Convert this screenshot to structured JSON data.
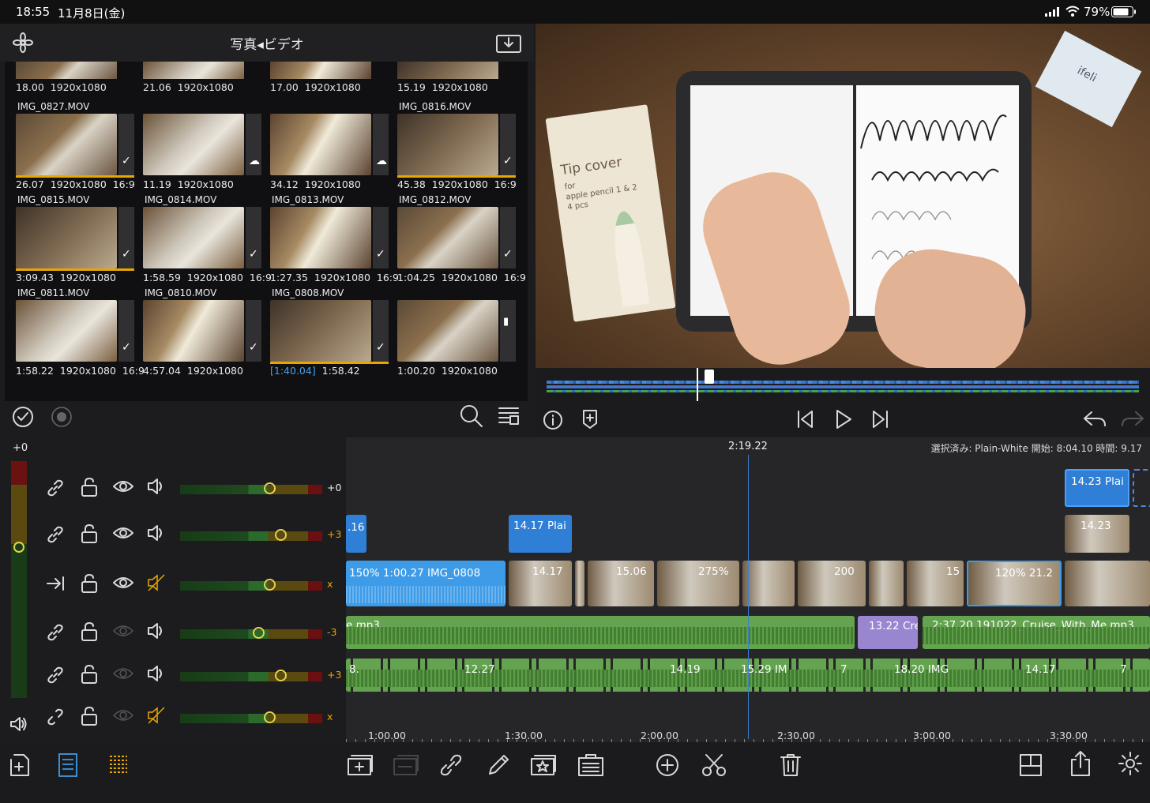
{
  "status_bar": {
    "time": "18:55",
    "date": "11月8日(金)",
    "battery": "79%"
  },
  "browser": {
    "title": "写真◂ビデオ",
    "top_row": [
      {
        "duration": "18.00",
        "resolution": "1920x1080"
      },
      {
        "duration": "21.06",
        "resolution": "1920x1080"
      },
      {
        "duration": "17.00",
        "resolution": "1920x1080"
      },
      {
        "duration": "15.19",
        "resolution": "1920x1080"
      }
    ],
    "clips": [
      {
        "name": "IMG_0827.MOV",
        "duration": "26.07",
        "resolution": "1920x1080",
        "aspect": "16:9",
        "used": true
      },
      {
        "name": "",
        "duration": "11.19",
        "resolution": "1920x1080",
        "aspect": "",
        "used": false
      },
      {
        "name": "",
        "duration": "34.12",
        "resolution": "1920x1080",
        "aspect": "",
        "used": false
      },
      {
        "name": "IMG_0816.MOV",
        "duration": "45.38",
        "resolution": "1920x1080",
        "aspect": "16:9",
        "used": true
      },
      {
        "name": "IMG_0815.MOV",
        "duration": "3:09.43",
        "resolution": "1920x1080",
        "aspect": "",
        "used": true
      },
      {
        "name": "IMG_0814.MOV",
        "duration": "1:58.59",
        "resolution": "1920x1080",
        "aspect": "16:9",
        "used": false
      },
      {
        "name": "IMG_0813.MOV",
        "duration": "1:27.35",
        "resolution": "1920x1080",
        "aspect": "16:9",
        "used": false
      },
      {
        "name": "IMG_0812.MOV",
        "duration": "1:04.25",
        "resolution": "1920x1080",
        "aspect": "16:9",
        "used": false
      },
      {
        "name": "IMG_0811.MOV",
        "duration": "1:58.22",
        "resolution": "1920x1080",
        "aspect": "16:9",
        "used": false
      },
      {
        "name": "IMG_0810.MOV",
        "duration": "4:57.04",
        "resolution": "1920x1080",
        "aspect": "",
        "used": false
      },
      {
        "name": "IMG_0808.MOV",
        "duration": "1:58.42",
        "resolution": "",
        "aspect": "",
        "used": true,
        "range": "[1:40.04]"
      },
      {
        "name": "",
        "duration": "1:00.20",
        "resolution": "1920x1080",
        "aspect": "",
        "used": false
      }
    ]
  },
  "viewer": {
    "box_text_1": "Tip cover",
    "box_text_2": "for",
    "box_text_3": "apple pencil 1 & 2",
    "box_text_4": "4 pcs",
    "brand": "ifeli"
  },
  "timeline": {
    "master_level": "+0",
    "playhead_time": "2:19.22",
    "selection_info": "選択済み: Plain-White 開始: 8:04.10 時間: 9.17",
    "tracks": [
      {
        "value": "+0",
        "muted": false
      },
      {
        "value": "+3",
        "muted": false
      },
      {
        "value": "x",
        "muted": true
      },
      {
        "value": "-3",
        "muted": false
      },
      {
        "value": "+3",
        "muted": false
      },
      {
        "value": "x",
        "muted": true
      }
    ],
    "title_clips": [
      {
        "label": ".16"
      },
      {
        "label": "14.17   Plai"
      },
      {
        "label": "14.23   Plai"
      },
      {
        "label": "14.23"
      }
    ],
    "main_clip": {
      "label": "150%   1:00.27   IMG_0808"
    },
    "video_strip_labels": [
      "14.17",
      "15.06",
      "275%",
      "200",
      "15",
      "120%  21.2"
    ],
    "music_clips": [
      {
        "label": "e.mp3"
      },
      {
        "label": "13.22   Cre"
      },
      {
        "label": "2:37.20   191022_Cruise_With_Me.mp3"
      }
    ],
    "audio_strip_labels": [
      "8.",
      "12.27",
      "14.19",
      "15.29  IM",
      "7",
      "18.20   IMG",
      "14.17",
      "7"
    ],
    "ruler": [
      "1:00.00",
      "1:30.00",
      "2:00.00",
      "2:30.00",
      "3:00.00",
      "3:30.00"
    ]
  }
}
